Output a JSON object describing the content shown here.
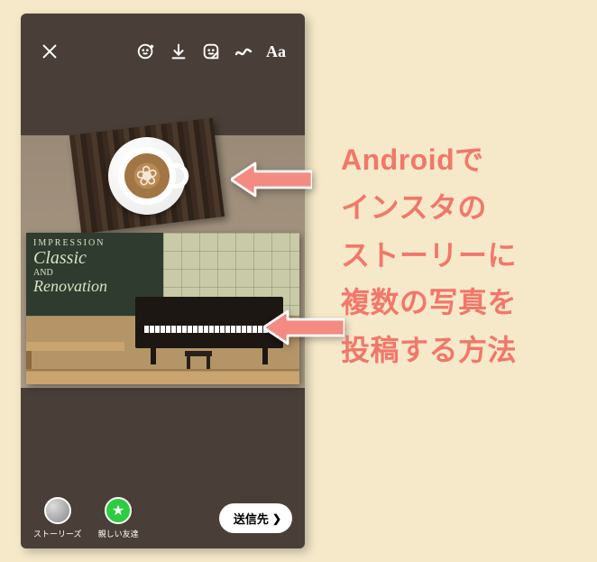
{
  "headline": {
    "line1": "Androidで",
    "line2": "インスタの",
    "line3": "ストーリーに",
    "line4": "複数の写真を",
    "line5": "投稿する方法"
  },
  "toolbar": {
    "close": "close-icon",
    "face": "face-effect-icon",
    "download": "download-icon",
    "sticker": "sticker-icon",
    "draw": "draw-icon",
    "text_label": "Aa"
  },
  "canvas": {
    "chalkboard": {
      "line1": "IMPRESSION",
      "line2": "Classic",
      "line3": "AND",
      "line4": "Renovation"
    }
  },
  "bottom": {
    "stories_label": "ストーリーズ",
    "close_friends_label": "親しい友達",
    "send_label": "送信先"
  }
}
